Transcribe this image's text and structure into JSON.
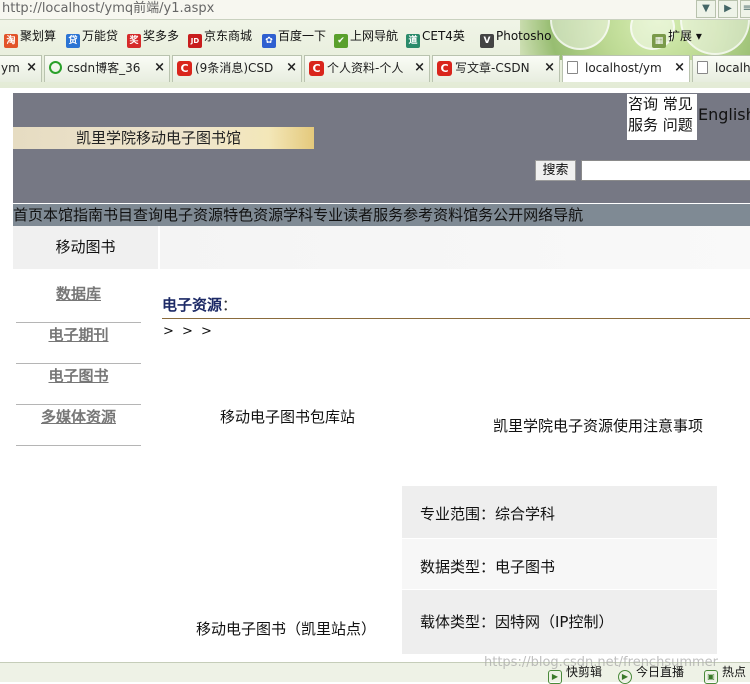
{
  "browser": {
    "address_url": "http://localhost/ymq前端/y1.aspx",
    "bookmarks": [
      {
        "label": "聚划算",
        "icon": "juhuasuan-icon",
        "color": "#e2542a",
        "glyph": "淘"
      },
      {
        "label": "万能贷",
        "icon": "wannengdai-icon",
        "color": "#2b74d4",
        "glyph": "贷"
      },
      {
        "label": "奖多多",
        "icon": "jiangduoduo-icon",
        "color": "#d62a2a",
        "glyph": "奖"
      },
      {
        "label": "京东商城",
        "icon": "jd-icon",
        "color": "#c81d1d",
        "glyph": "JD"
      },
      {
        "label": "百度一下",
        "icon": "baidu-paw-icon",
        "color": "#2f5fd0",
        "glyph": "✿"
      },
      {
        "label": "上网导航",
        "icon": "hao123-icon",
        "color": "#5aa02c",
        "glyph": "✔"
      },
      {
        "label": "CET4英",
        "icon": "cet4-icon",
        "color": "#2a8a6a",
        "glyph": "道"
      },
      {
        "label": "Photosho",
        "icon": "photoshop-icon",
        "color": "#444444",
        "glyph": "V"
      }
    ],
    "extensions_label": "扩展",
    "tabs": [
      {
        "label": "ym",
        "icon": "page-icon"
      },
      {
        "label": "csdn博客_36",
        "icon": "baidu-search-icon"
      },
      {
        "label": "(9条消息)CSD",
        "icon": "csdn-icon"
      },
      {
        "label": "个人资料-个人",
        "icon": "csdn-icon"
      },
      {
        "label": "写文章-CSDN",
        "icon": "csdn-icon"
      },
      {
        "label": "localhost/ym",
        "icon": "page-icon"
      },
      {
        "label": "localh",
        "icon": "page-icon"
      }
    ],
    "tab_close_glyph": "×"
  },
  "site": {
    "title": "凯里学院移动电子图书馆",
    "quicklinks": [
      "咨询",
      "常见",
      "服务",
      "问题"
    ],
    "english_link": "English",
    "search_button": "搜索",
    "search_placeholder": "",
    "nav": [
      "首页",
      "本馆指南",
      "书目查询",
      "电子资源",
      "特色资源",
      "学科专业",
      "读者服务",
      "参考资料",
      "馆务公开",
      "网络导航"
    ],
    "current_tab": "移动图书"
  },
  "sidebar": {
    "items": [
      "数据库",
      "电子期刊",
      "电子图书",
      "多媒体资源"
    ]
  },
  "content": {
    "section_title": "电子资源",
    "section_colon": "：",
    "breadcrumb": "> > >",
    "link_package": "移动电子图书包库站",
    "notice_link": "凯里学院电子资源使用注意事项",
    "ebook_site": "移动电子图书（凯里站点）",
    "info": [
      {
        "text": "专业范围：综合学科"
      },
      {
        "text": "数据类型：电子图书"
      },
      {
        "text": "载体类型：因特网（IP控制）"
      }
    ]
  },
  "footer": {
    "watermark": "https://blog.csdn.net/frenchsummer",
    "items": [
      {
        "label": "快剪辑",
        "icon": "scissors-icon",
        "glyph": "▶"
      },
      {
        "label": "今日直播",
        "icon": "live-icon",
        "glyph": "▶"
      },
      {
        "label": "热点",
        "icon": "hot-news-icon",
        "glyph": "▣"
      }
    ]
  }
}
